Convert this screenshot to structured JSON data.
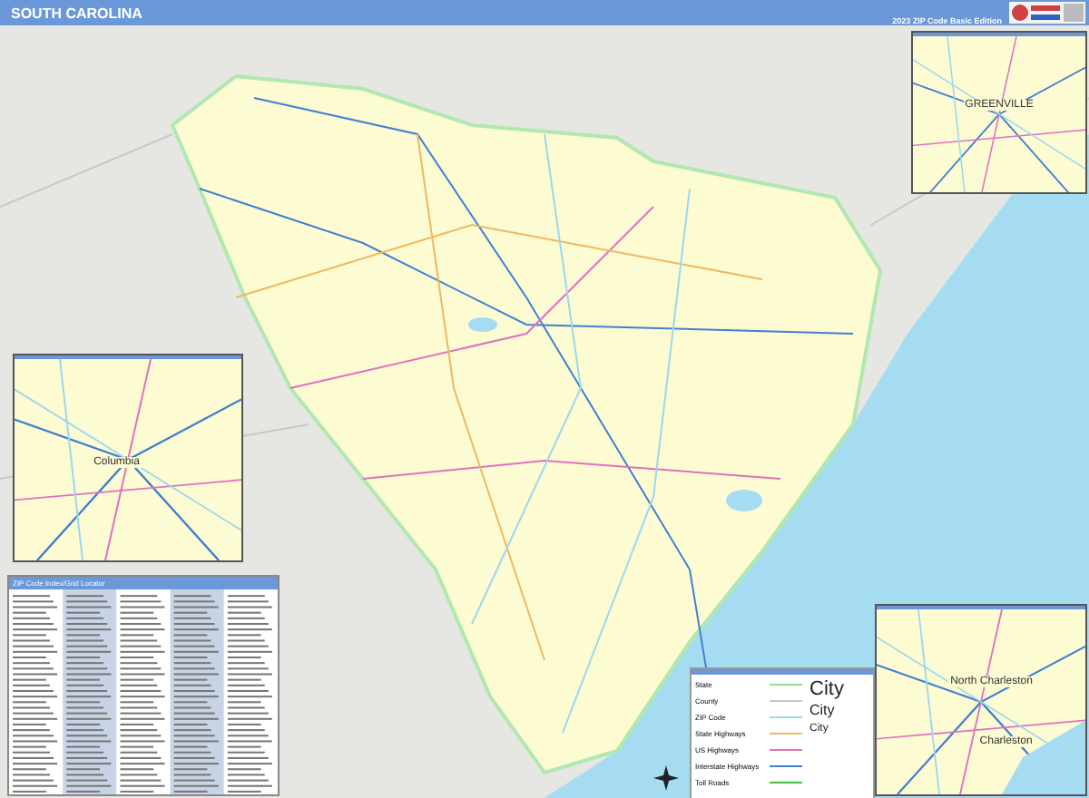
{
  "header": {
    "title": "SOUTH CAROLINA",
    "edition": "2023 ZIP Code Basic Edition"
  },
  "insets": [
    {
      "kind": "greenville",
      "labels": [
        "GREENVILLE"
      ]
    },
    {
      "kind": "columbia",
      "labels": [
        "Columbia"
      ]
    },
    {
      "kind": "charleston",
      "labels": [
        "North Charleston",
        "Charleston"
      ]
    }
  ],
  "index": {
    "title": "ZIP Code Index/Grid Locator"
  },
  "legend": {
    "items": [
      {
        "label": "State",
        "kind": "state"
      },
      {
        "label": "County",
        "kind": "county"
      },
      {
        "label": "ZIP Code",
        "kind": "zip"
      },
      {
        "label": "State Highways",
        "kind": "state_hwy"
      },
      {
        "label": "US Highways",
        "kind": "us_hwy"
      },
      {
        "label": "Interstate Highways",
        "kind": "interstate"
      },
      {
        "label": "Toll Roads",
        "kind": "toll"
      }
    ],
    "cities": [
      {
        "label": "City",
        "kind": "large"
      },
      {
        "label": "City",
        "kind": "medium"
      },
      {
        "label": "City",
        "kind": "small"
      }
    ]
  }
}
